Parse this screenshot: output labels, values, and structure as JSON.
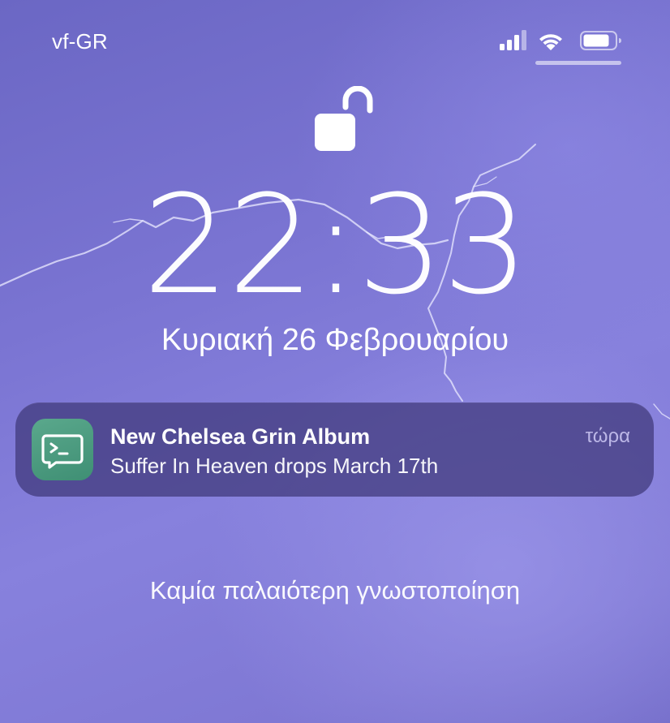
{
  "status_bar": {
    "carrier": "vf-GR",
    "icons": [
      "cellular-signal-icon",
      "wifi-icon",
      "battery-icon"
    ]
  },
  "lock_screen": {
    "lock_state_icon": "unlocked-padlock-icon",
    "time": "22:33",
    "date": "Κυριακή 26 Φεβρουαρίου"
  },
  "notification": {
    "app_icon": "terminal-prompt-icon",
    "title": "New Chelsea Grin Album",
    "body": "Suffer In Heaven drops March 17th",
    "time": "τώρα"
  },
  "footer": {
    "no_older_notifications": "Καμία παλαιότερη γνωστοποίηση"
  },
  "colors": {
    "wallpaper": "#7a74d2",
    "notification_bg": "#3e3778",
    "app_icon": "#4a9a7e"
  }
}
